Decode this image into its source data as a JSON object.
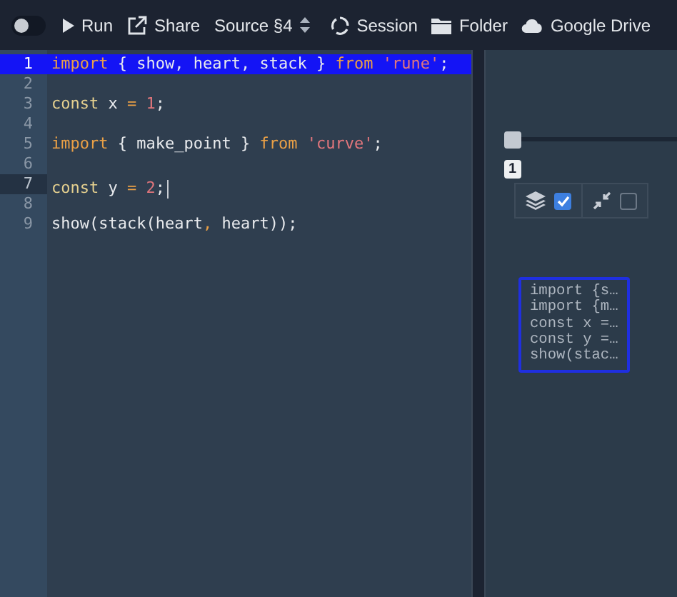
{
  "toolbar": {
    "toggle": {
      "on": false
    },
    "buttons": [
      {
        "kind": "run",
        "label": "Run"
      },
      {
        "kind": "share",
        "label": "Share"
      },
      {
        "kind": "source",
        "label": "Source §4"
      },
      {
        "kind": "session",
        "label": "Session"
      },
      {
        "kind": "folder",
        "label": "Folder"
      },
      {
        "kind": "drive",
        "label": "Google Drive"
      }
    ]
  },
  "editor": {
    "lines": [
      {
        "number": "1",
        "selected": true,
        "active": false,
        "tokens": [
          {
            "kind": "keyword",
            "text": "import"
          },
          {
            "kind": "plain",
            "text": " { show, heart, stack } "
          },
          {
            "kind": "keyword",
            "text": "from "
          },
          {
            "kind": "string",
            "text": "'rune'"
          },
          {
            "kind": "plain",
            "text": ";"
          }
        ]
      },
      {
        "number": "2",
        "selected": false,
        "active": false
      },
      {
        "number": "3",
        "selected": false,
        "active": false,
        "tokens": [
          {
            "kind": "decl",
            "text": "const"
          },
          {
            "kind": "plain",
            "text": " x "
          },
          {
            "kind": "operator",
            "text": "= "
          },
          {
            "kind": "number",
            "text": "1"
          },
          {
            "kind": "plain",
            "text": ";"
          }
        ]
      },
      {
        "number": "4",
        "selected": false,
        "active": false
      },
      {
        "number": "5",
        "selected": false,
        "active": false,
        "tokens": [
          {
            "kind": "keyword",
            "text": "import"
          },
          {
            "kind": "plain",
            "text": " { make_point } "
          },
          {
            "kind": "keyword",
            "text": "from "
          },
          {
            "kind": "string",
            "text": "'curve'"
          },
          {
            "kind": "plain",
            "text": ";"
          }
        ]
      },
      {
        "number": "6",
        "selected": false,
        "active": false
      },
      {
        "number": "7",
        "selected": false,
        "active": true,
        "tokens": [
          {
            "kind": "decl",
            "text": "const"
          },
          {
            "kind": "plain",
            "text": " y "
          },
          {
            "kind": "operator",
            "text": "= "
          },
          {
            "kind": "number",
            "text": "2"
          },
          {
            "kind": "plain",
            "text": ";"
          }
        ]
      },
      {
        "number": "8",
        "selected": false,
        "active": false
      },
      {
        "number": "9",
        "selected": false,
        "active": false,
        "tokens": [
          {
            "kind": "plain",
            "text": "show(stack(heart"
          },
          {
            "kind": "operator",
            "text": ","
          },
          {
            "kind": "plain",
            "text": " heart));"
          }
        ]
      }
    ]
  },
  "viewer": {
    "slider": {
      "level": 0,
      "value": "1"
    },
    "options": [
      {
        "kind": "layers",
        "checked": true
      },
      {
        "kind": "fullscreen",
        "checked": false
      }
    ],
    "preview": [
      "import {s…",
      "import {m…",
      "const x =…",
      "const y =…",
      "show(stac…"
    ]
  }
}
